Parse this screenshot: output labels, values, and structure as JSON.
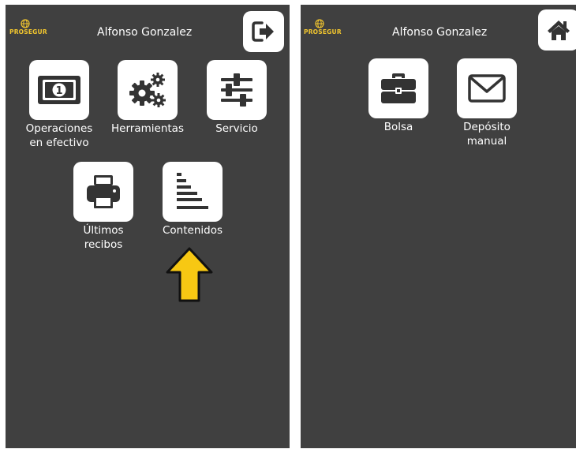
{
  "left_screen": {
    "logo_text": "PROSEGUR",
    "user_name": "Alfonso Gonzalez",
    "corner_icon": "logout-icon",
    "tiles": [
      {
        "icon": "cash-icon",
        "label_line1": "Operaciones",
        "label_line2": "en efectivo"
      },
      {
        "icon": "gears-icon",
        "label_line1": "Herramientas",
        "label_line2": ""
      },
      {
        "icon": "sliders-icon",
        "label_line1": "Servicio",
        "label_line2": ""
      },
      {
        "icon": "printer-icon",
        "label_line1": "Últimos",
        "label_line2": "recibos"
      },
      {
        "icon": "bars-icon",
        "label_line1": "Contenidos",
        "label_line2": ""
      }
    ],
    "pointer": {
      "icon": "up-arrow-icon",
      "color": "#f7c813"
    }
  },
  "right_screen": {
    "logo_text": "PROSEGUR",
    "user_name": "Alfonso Gonzalez",
    "corner_icon": "home-icon",
    "tiles": [
      {
        "icon": "briefcase-icon",
        "label_line1": "Bolsa",
        "label_line2": ""
      },
      {
        "icon": "envelope-icon",
        "label_line1": "Depósito",
        "label_line2": "manual"
      }
    ]
  },
  "colors": {
    "background": "#404040",
    "tile": "#ffffff",
    "icon": "#333333",
    "brand": "#f2c62e",
    "arrow": "#f7c813"
  }
}
